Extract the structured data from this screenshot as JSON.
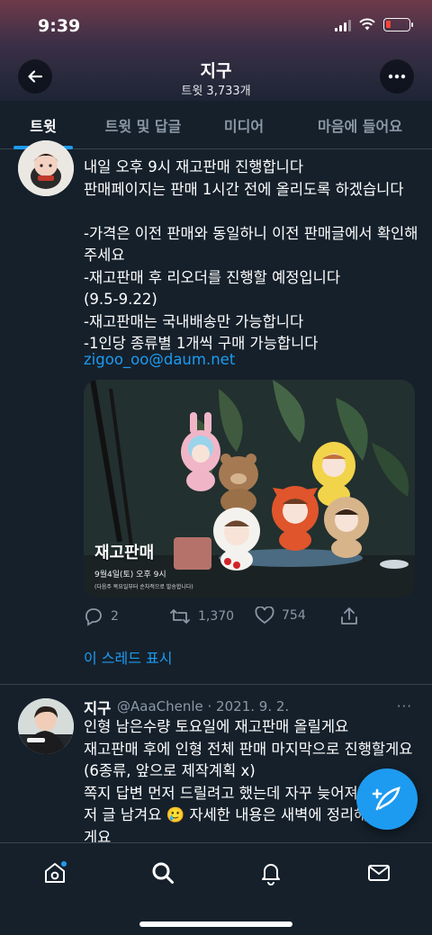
{
  "status_bar": {
    "time": "9:39"
  },
  "header": {
    "name": "지구",
    "tweet_count": "트윗 3,733개"
  },
  "tabs": [
    {
      "label": "트윗",
      "active": true
    },
    {
      "label": "트윗 및 답글",
      "active": false
    },
    {
      "label": "미디어",
      "active": false
    },
    {
      "label": "마음에 들어요",
      "active": false
    }
  ],
  "tweet1": {
    "text": "내일 오후 9시 재고판매 진행합니다\n판매페이지는 판매 1시간 전에 올리도록 하겠습니다\n\n-가격은 이전 판매와 동일하니 이전 판매글에서 확인해주세요\n-재고판매 후 리오더를 진행할 예정입니다\n(9.5-9.22)\n-재고판매는 국내배송만 가능합니다\n-1인당 종류별 1개씩 구매 가능합니다",
    "email": "zigoo_oo@daum.net",
    "image": {
      "title": "재고판매",
      "date": "9월4일(토) 오후 9시",
      "note": "(다음주 목요일부터 순차적으로 발송합니다)"
    },
    "stats": {
      "replies": "2",
      "retweets": "1,370",
      "likes": "754"
    },
    "thread_link": "이 스레드 표시"
  },
  "tweet2": {
    "name": "지구",
    "handle": "@AaaChenle · 2021. 9. 2.",
    "more": "···",
    "text": "인형 남은수량 토요일에 재고판매 올릴게요\n재고판매 후에 인형 전체 판매 마지막으로 진행할게요 (6종류, 앞으로 제작계획 x)\n쪽지 답변 먼저 드릴려고 했는데 자꾸 늦어져서\n저 글 남겨요 🥲 자세한 내용은 새벽에 정리해둘\n게요"
  },
  "colors": {
    "background": "#15202b",
    "accent": "#1d9bf0",
    "muted": "#8b98a5",
    "divider": "#38444d"
  },
  "icons": [
    "back-arrow-icon",
    "more-icon",
    "reply-icon",
    "retweet-icon",
    "like-icon",
    "share-icon",
    "compose-icon",
    "home-icon",
    "search-icon",
    "notifications-icon",
    "messages-icon"
  ]
}
